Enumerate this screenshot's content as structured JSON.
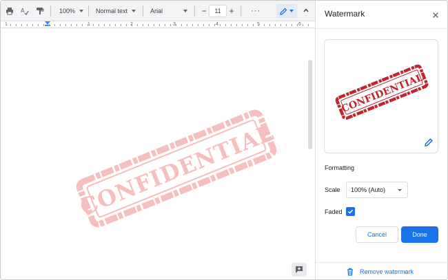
{
  "toolbar": {
    "zoom": "100%",
    "paragraph_style": "Normal text",
    "font": "Arial",
    "font_size": "11",
    "decrease": "−",
    "increase": "+",
    "more": "···"
  },
  "ruler": {
    "numbers": [
      "1",
      "1",
      "2",
      "3",
      "4",
      "5",
      "6"
    ]
  },
  "document": {
    "watermark_text": "CONFIDENTIAL"
  },
  "panel": {
    "title": "Watermark",
    "preview_text": "CONFIDENTIAL",
    "formatting_label": "Formatting",
    "scale_label": "Scale",
    "scale_value": "100% (Auto)",
    "faded_label": "Faded",
    "faded_checked": true,
    "cancel_label": "Cancel",
    "done_label": "Done",
    "remove_label": "Remove watermark"
  },
  "colors": {
    "accent": "#1a73e8",
    "stamp_red": "#c2242d",
    "stamp_faded": "#f4b8b8"
  },
  "icons": [
    "print-icon",
    "spellcheck-icon",
    "paint-format-icon",
    "pen-icon",
    "chevron-up-icon",
    "close-icon",
    "edit-pencil-icon",
    "check-icon",
    "trash-icon",
    "add-comment-icon"
  ]
}
